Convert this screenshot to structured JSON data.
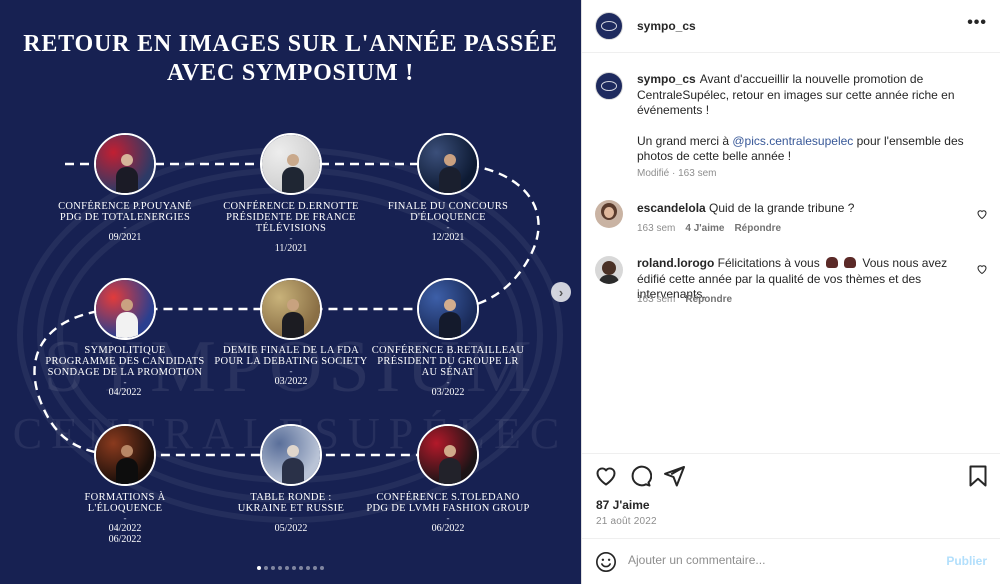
{
  "image": {
    "title_line1": "RETOUR EN IMAGES SUR L'ANNÉE PASSÉE",
    "title_line2": "AVEC SYMPOSIUM !",
    "watermark_big": "SYMPOSIUM",
    "watermark_small": "CENTRALESUPÉLEC",
    "events": [
      {
        "id": "pouyane",
        "title": "CONFÉRENCE P.POUYANÉ",
        "subtitle": "PDG DE TOTALENERGIES",
        "sep": "-",
        "date": "09/2021",
        "palette": {
          "bg": "#2d3a66",
          "accent": "#c21f32",
          "body": "#1b1b26",
          "head": "#d6b59a"
        }
      },
      {
        "id": "ernotte",
        "title": "CONFÉRENCE D.ERNOTTE",
        "subtitle": "PRÉSIDENTE DE FRANCE TÉLÉVISIONS",
        "sep": "-",
        "date": "11/2021",
        "palette": {
          "bg": "#cfcfcf",
          "accent": "#ededed",
          "body": "#1f2633",
          "head": "#c9a98c"
        }
      },
      {
        "id": "concours",
        "title": "FINALE DU CONCOURS",
        "subtitle": "D'ÉLOQUENCE",
        "sep": "-",
        "date": "12/2021",
        "palette": {
          "bg": "#0d1a33",
          "accent": "#3b4f7a",
          "body": "#1a1f2e",
          "head": "#caa181"
        }
      },
      {
        "id": "sympolitique",
        "title": "SYMPOLITIQUE",
        "subtitle": "PROGRAMME DES CANDIDATS",
        "subtitle2": "SONDAGE DE LA PROMOTION",
        "sep": "-",
        "date": "04/2022",
        "palette": {
          "bg": "#2a3f8f",
          "accent": "#e23b3b",
          "body": "#f2f2f2",
          "head": "#caa181"
        }
      },
      {
        "id": "fda",
        "title": "DEMIE FINALE DE LA FDA",
        "subtitle": "POUR LA DEBATING SOCIETY",
        "sep": "-",
        "date": "03/2022",
        "palette": {
          "bg": "#8a6f45",
          "accent": "#c8b27a",
          "body": "#1c1c22",
          "head": "#c8a27f"
        }
      },
      {
        "id": "retailleau",
        "title": "CONFÉRENCE B.RETAILLEAU",
        "subtitle": "PRÉSIDENT DU GROUPE LR",
        "subtitle2": "AU SÉNAT",
        "sep": "-",
        "date": "03/2022",
        "palette": {
          "bg": "#1a2b5a",
          "accent": "#3d5fa8",
          "body": "#141a2c",
          "head": "#d2ad8e"
        }
      },
      {
        "id": "formations",
        "title": "FORMATIONS À",
        "subtitle": "L'ÉLOQUENCE",
        "sep": "-",
        "date": "04/2022",
        "date2": "06/2022",
        "palette": {
          "bg": "#1a0f0a",
          "accent": "#8a3a1e",
          "body": "#0d0d0d",
          "head": "#b88766"
        }
      },
      {
        "id": "tableronde",
        "title": "TABLE RONDE :",
        "subtitle": "UKRAINE ET RUSSIE",
        "sep": "-",
        "date": "05/2022",
        "palette": {
          "bg": "#b9c3d6",
          "accent": "#5a6f9a",
          "body": "#2a3148",
          "head": "#e0d6cc"
        }
      },
      {
        "id": "toledano",
        "title": "CONFÉRENCE S.TOLEDANO",
        "subtitle": "PDG DE LVMH FASHION GROUP",
        "sep": "-",
        "date": "06/2022",
        "palette": {
          "bg": "#1c1416",
          "accent": "#b3192a",
          "body": "#22222a",
          "head": "#d0aa8a"
        }
      }
    ],
    "carousel_dots": 10,
    "carousel_active": 0,
    "next_glyph": "›"
  },
  "post": {
    "account": "sympo_cs",
    "more_glyph": "•••",
    "caption_text": "Avant d'accueillir la nouvelle promotion de CentraleSupélec, retour en images sur cette année riche en événements !",
    "caption_thanks_before": "Un grand merci à ",
    "caption_mention": "@pics.centralesupelec",
    "caption_thanks_after": " pour l'ensemble des photos de cette belle année !",
    "caption_meta": "Modifié · 163 sem",
    "comments": [
      {
        "user": "escandelola",
        "text": "Quid de la grande tribune ?",
        "time": "163 sem",
        "likes": "4 J'aime",
        "reply": "Répondre"
      },
      {
        "user": "roland.lorogo",
        "text_before": "Félicitations à vous ",
        "text_after": " Vous nous avez édifié cette année par la qualité de vos thèmes et des intervenants.",
        "time": "163 sem",
        "reply": "Répondre"
      }
    ],
    "likes": "87 J'aime",
    "date": "21 août 2022",
    "add_comment_placeholder": "Ajouter un commentaire...",
    "publish": "Publier"
  },
  "icons": {
    "heart": "heart-icon",
    "comment": "comment-icon",
    "share": "share-icon",
    "bookmark": "bookmark-icon",
    "emoji": "emoji-icon",
    "clap": "clapping-hands-icon"
  },
  "colors": {
    "image_bg": "#172152",
    "link": "#385898",
    "publish_disabled": "#b2dffc",
    "muted": "#8e8e8e"
  }
}
